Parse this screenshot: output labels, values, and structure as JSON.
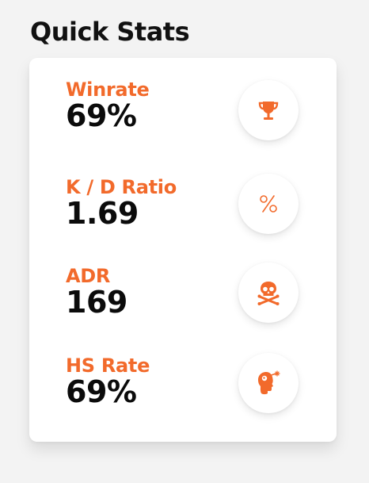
{
  "page": {
    "title": "Quick Stats"
  },
  "stats": [
    {
      "label": "Winrate",
      "value": "69%",
      "icon": "trophy-icon"
    },
    {
      "label": "K / D Ratio",
      "value": "1.69",
      "icon": "percent-icon"
    },
    {
      "label": "ADR",
      "value": "169",
      "icon": "skull-crossbones-icon"
    },
    {
      "label": "HS Rate",
      "value": "69%",
      "icon": "headshot-icon"
    }
  ],
  "colors": {
    "accent": "#f26a2b",
    "value_text": "#0b0b0b",
    "card_background": "#ffffff",
    "page_background": "#f3f3f3"
  }
}
